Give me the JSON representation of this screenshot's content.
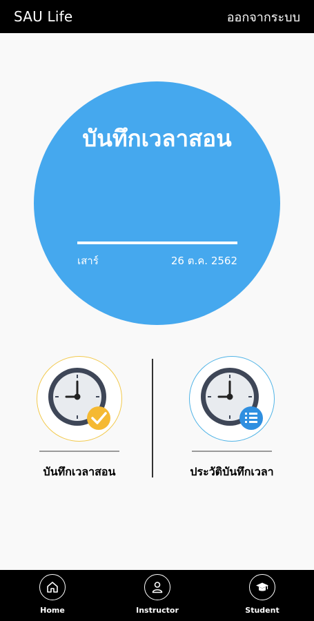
{
  "header": {
    "title": "SAU Life",
    "logout_label": "ออกจากระบบ"
  },
  "hero": {
    "title": "บันทึกเวลาสอน",
    "day": "เสาร์",
    "date": "26 ต.ค. 2562",
    "color": "#45a8ee"
  },
  "actions": [
    {
      "label": "บันทึกเวลาสอน",
      "icon": "clock-check-icon",
      "ring_color": "#f2c94c"
    },
    {
      "label": "ประวัติบันทึกเวลา",
      "icon": "clock-list-icon",
      "ring_color": "#4fb3e6"
    }
  ],
  "bottom_nav": [
    {
      "label": "Home",
      "icon": "home-icon"
    },
    {
      "label": "Instructor",
      "icon": "user-icon"
    },
    {
      "label": "Student",
      "icon": "graduation-cap-icon"
    }
  ]
}
